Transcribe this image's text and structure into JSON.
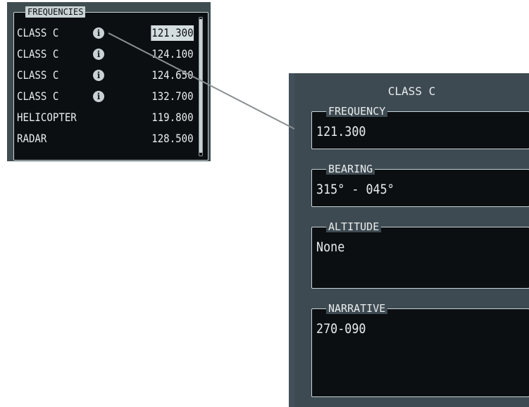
{
  "frequencies": {
    "title": "FREQUENCIES",
    "rows": [
      {
        "name": "CLASS C",
        "has_info": true,
        "value": "121.300",
        "selected": true
      },
      {
        "name": "CLASS C",
        "has_info": true,
        "value": "124.100",
        "selected": false
      },
      {
        "name": "CLASS C",
        "has_info": true,
        "value": "124.650",
        "selected": false
      },
      {
        "name": "CLASS C",
        "has_info": true,
        "value": "132.700",
        "selected": false
      },
      {
        "name": "HELICOPTER",
        "has_info": false,
        "value": "119.800",
        "selected": false
      },
      {
        "name": "RADAR",
        "has_info": false,
        "value": "128.500",
        "selected": false
      }
    ],
    "info_glyph": "i"
  },
  "detail": {
    "title": "CLASS C",
    "fields": [
      {
        "label": "FREQUENCY",
        "value": "121.300"
      },
      {
        "label": "BEARING",
        "value": "315° - 045°"
      },
      {
        "label": "ALTITUDE",
        "value": "None"
      },
      {
        "label": "NARRATIVE",
        "value": "270-090"
      }
    ]
  },
  "colors": {
    "panel_bg": "#3f4c50",
    "screen_bg": "#0b0f12",
    "text": "#e8ecee",
    "highlight": "#d4dde0",
    "connector": "#8a8f91"
  }
}
